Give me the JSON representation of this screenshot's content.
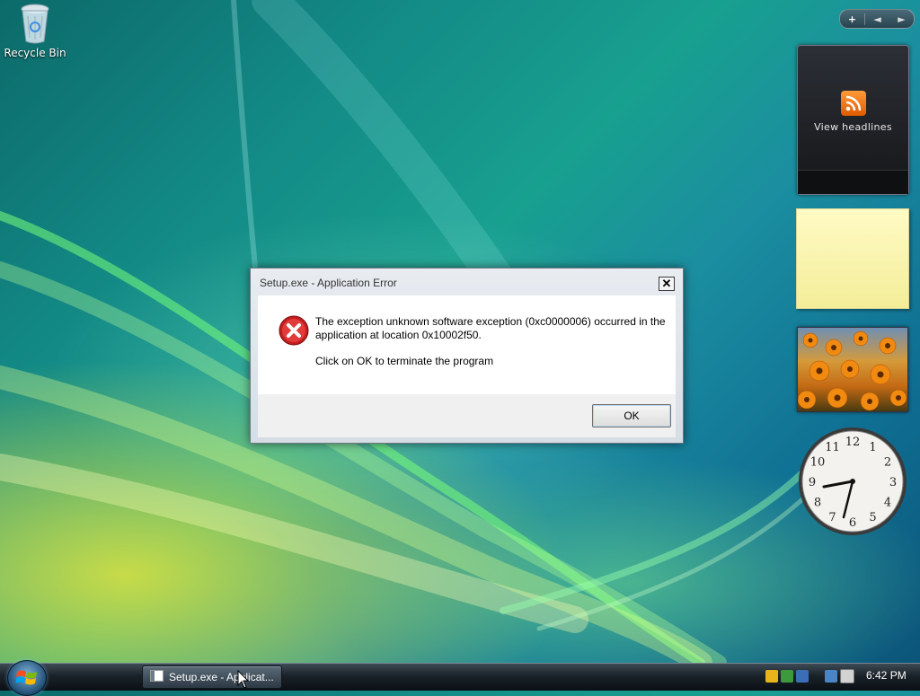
{
  "desktop": {
    "icons": [
      {
        "label": "Recycle Bin",
        "icon": "recycle-bin-icon"
      }
    ]
  },
  "gadgets": {
    "toolbar": {
      "add_label": "+",
      "prev_label": "◄",
      "next_label": "►"
    },
    "feed": {
      "label": "View headlines",
      "icon": "rss-icon"
    },
    "clock": {
      "time": "6:42",
      "numerals": [
        "12",
        "1",
        "2",
        "3",
        "4",
        "5",
        "6",
        "7",
        "8",
        "9",
        "10",
        "11"
      ]
    }
  },
  "dialog": {
    "title": "Setup.exe - Application Error",
    "close_label": "✕",
    "message_line1": "The exception unknown software exception (0xc0000006) occurred in the application at location 0x10002f50.",
    "message_line2": "Click on OK to terminate the program",
    "ok_label": "OK",
    "icon": "error-icon"
  },
  "taskbar": {
    "start_icon": "windows-logo-icon",
    "task_label": "Setup.exe - Applicat...",
    "clock": "6:42 PM"
  },
  "colors": {
    "error": "#d12a2a",
    "rss": "#f07a12",
    "note": "#fff7b0"
  }
}
